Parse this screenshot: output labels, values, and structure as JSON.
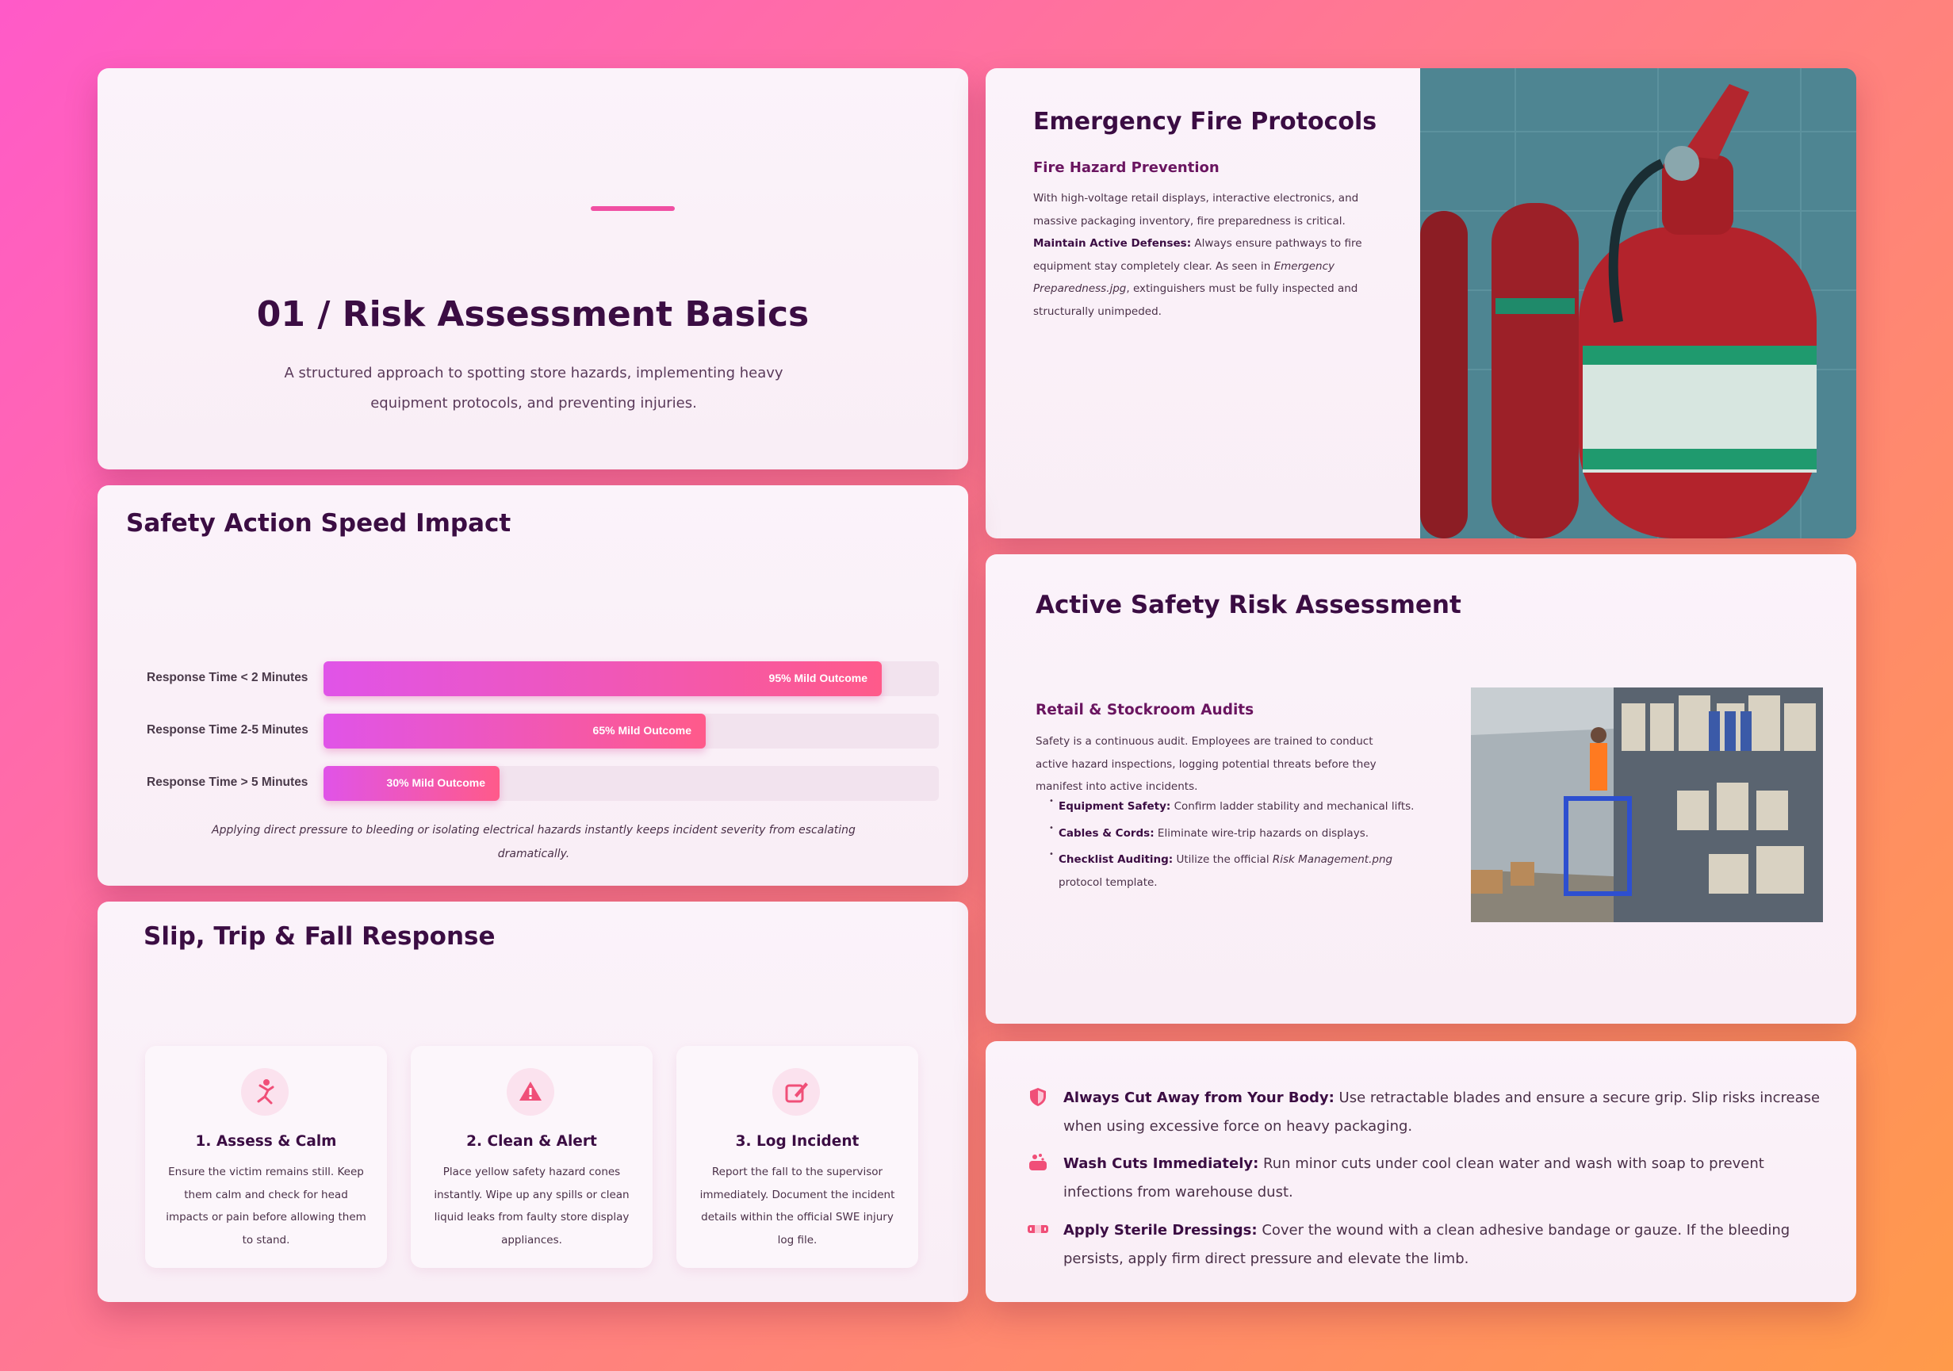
{
  "intro": {
    "title": "01 / Risk Assessment Basics",
    "subtitle": "A structured approach to spotting store hazards, implementing heavy equipment protocols, and preventing injuries."
  },
  "fire": {
    "title": "Emergency Fire Protocols",
    "subtitle": "Fire Hazard Prevention",
    "p1": "With high-voltage retail displays, interactive electronics, and massive packaging inventory, fire preparedness is critical.",
    "p2_bold": "Maintain Active Defenses:",
    "p2_a": "Always ensure pathways to fire equipment stay completely clear. As seen in",
    "p2_file": "Emergency Preparedness.jpg",
    "p2_b": ", extinguishers must be fully inspected and structurally unimpeded."
  },
  "chart_data": {
    "type": "bar",
    "title": "Safety Action Speed Impact",
    "categories": [
      "Response Time < 2 Minutes",
      "Response Time 2-5 Minutes",
      "Response Time > 5 Minutes"
    ],
    "values": [
      95,
      65,
      30
    ],
    "value_labels": [
      "95% Mild Outcome",
      "65% Mild Outcome",
      "30% Mild Outcome"
    ],
    "xlim": [
      0,
      100
    ],
    "orientation": "horizontal",
    "note": "Applying direct pressure to bleeding or isolating electrical hazards instantly keeps incident severity from escalating dramatically."
  },
  "slip": {
    "title": "Slip, Trip & Fall Response",
    "steps": [
      {
        "icon": "person-falling-icon",
        "title": "1. Assess & Calm",
        "text": "Ensure the victim remains still. Keep them calm and check for head impacts or pain before allowing them to stand."
      },
      {
        "icon": "warning-triangle-icon",
        "title": "2. Clean & Alert",
        "text": "Place yellow safety hazard cones instantly. Wipe up any spills or clean liquid leaks from faulty store display appliances."
      },
      {
        "icon": "edit-note-icon",
        "title": "3. Log Incident",
        "text": "Report the fall to the supervisor immediately. Document the incident details within the official SWE injury log file."
      }
    ]
  },
  "active": {
    "title": "Active Safety Risk Assessment",
    "subtitle": "Retail & Stockroom Audits",
    "body": "Safety is a continuous audit. Employees are trained to conduct active hazard inspections, logging potential threats before they manifest into active incidents.",
    "items": [
      {
        "bold": "Equipment Safety:",
        "text": "Confirm ladder stability and mechanical lifts."
      },
      {
        "bold": "Cables & Cords:",
        "text": "Eliminate wire-trip hazards on displays."
      },
      {
        "bold": "Checklist Auditing:",
        "text": "Utilize the official",
        "file": "Risk Management.png",
        "tail": "protocol template."
      }
    ]
  },
  "tips": [
    {
      "icon": "shield-icon",
      "bold": "Always Cut Away from Your Body:",
      "text": "Use retractable blades and ensure a secure grip. Slip risks increase when using excessive force on heavy packaging."
    },
    {
      "icon": "soap-icon",
      "bold": "Wash Cuts Immediately:",
      "text": "Run minor cuts under cool clean water and wash with soap to prevent infections from warehouse dust."
    },
    {
      "icon": "bandage-icon",
      "bold": "Apply Sterile Dressings:",
      "text": "Cover the wound with a clean adhesive bandage or gauze. If the bleeding persists, apply firm direct pressure and elevate the limb."
    }
  ]
}
